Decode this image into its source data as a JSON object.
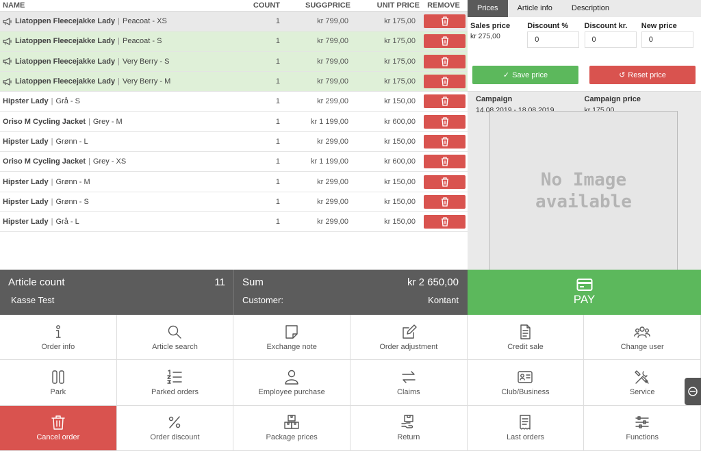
{
  "table": {
    "headers": {
      "name": "NAME",
      "count": "COUNT",
      "sugg": "SUGGPRICE",
      "unit": "UNIT PRICE",
      "remove": "REMOVE"
    },
    "rows": [
      {
        "name": "Liatoppen Fleecejakke Lady",
        "variant": "Peacoat - XS",
        "count": "1",
        "sugg": "kr 799,00",
        "unit": "kr 175,00",
        "campaign": true,
        "state": "selected"
      },
      {
        "name": "Liatoppen Fleecejakke Lady",
        "variant": "Peacoat - S",
        "count": "1",
        "sugg": "kr 799,00",
        "unit": "kr 175,00",
        "campaign": true,
        "state": "green"
      },
      {
        "name": "Liatoppen Fleecejakke Lady",
        "variant": "Very Berry - S",
        "count": "1",
        "sugg": "kr 799,00",
        "unit": "kr 175,00",
        "campaign": true,
        "state": "green"
      },
      {
        "name": "Liatoppen Fleecejakke Lady",
        "variant": "Very Berry - M",
        "count": "1",
        "sugg": "kr 799,00",
        "unit": "kr 175,00",
        "campaign": true,
        "state": "green"
      },
      {
        "name": "Hipster Lady",
        "variant": "Grå - S",
        "count": "1",
        "sugg": "kr 299,00",
        "unit": "kr 150,00",
        "campaign": false,
        "state": "normal"
      },
      {
        "name": "Oriso M Cycling Jacket",
        "variant": "Grey - M",
        "count": "1",
        "sugg": "kr 1 199,00",
        "unit": "kr 600,00",
        "campaign": false,
        "state": "normal"
      },
      {
        "name": "Hipster Lady",
        "variant": "Grønn - L",
        "count": "1",
        "sugg": "kr 299,00",
        "unit": "kr 150,00",
        "campaign": false,
        "state": "normal"
      },
      {
        "name": "Oriso M Cycling Jacket",
        "variant": "Grey - XS",
        "count": "1",
        "sugg": "kr 1 199,00",
        "unit": "kr 600,00",
        "campaign": false,
        "state": "normal"
      },
      {
        "name": "Hipster Lady",
        "variant": "Grønn - M",
        "count": "1",
        "sugg": "kr 299,00",
        "unit": "kr 150,00",
        "campaign": false,
        "state": "normal"
      },
      {
        "name": "Hipster Lady",
        "variant": "Grønn - S",
        "count": "1",
        "sugg": "kr 299,00",
        "unit": "kr 150,00",
        "campaign": false,
        "state": "normal"
      },
      {
        "name": "Hipster Lady",
        "variant": "Grå - L",
        "count": "1",
        "sugg": "kr 299,00",
        "unit": "kr 150,00",
        "campaign": false,
        "state": "normal"
      }
    ]
  },
  "panel": {
    "tabs": [
      "Prices",
      "Article info",
      "Description"
    ],
    "active_tab": "Prices",
    "sales_price_label": "Sales price",
    "sales_price_value": "kr 275,00",
    "discount_pct_label": "Discount %",
    "discount_pct_value": "0",
    "discount_kr_label": "Discount kr.",
    "discount_kr_value": "0",
    "new_price_label": "New price",
    "new_price_value": "0",
    "save_label": "Save price",
    "reset_label": "Reset price",
    "campaign_label": "Campaign",
    "campaign_value": "14.08.2019 - 18.08.2019",
    "campaign_price_label": "Campaign price",
    "campaign_price_value": "kr 175,00",
    "no_image_line1": "No Image",
    "no_image_line2": "available"
  },
  "summary": {
    "article_count_label": "Article count",
    "article_count_value": "11",
    "register_name": "Kasse Test",
    "sum_label": "Sum",
    "sum_value": "kr 2 650,00",
    "customer_label": "Customer:",
    "customer_value": "Kontant",
    "pay_label": "PAY"
  },
  "functions": [
    {
      "label": "Order info",
      "icon": "info-icon"
    },
    {
      "label": "Article search",
      "icon": "search-icon"
    },
    {
      "label": "Exchange note",
      "icon": "note-icon"
    },
    {
      "label": "Order adjustment",
      "icon": "edit-icon"
    },
    {
      "label": "Credit sale",
      "icon": "document-icon"
    },
    {
      "label": "Change user",
      "icon": "users-icon"
    },
    {
      "label": "Park",
      "icon": "pause-icon"
    },
    {
      "label": "Parked orders",
      "icon": "numbered-list-icon"
    },
    {
      "label": "Employee purchase",
      "icon": "person-icon"
    },
    {
      "label": "Claims",
      "icon": "swap-arrows-icon"
    },
    {
      "label": "Club/Business",
      "icon": "id-card-icon"
    },
    {
      "label": "Service",
      "icon": "tools-icon"
    },
    {
      "label": "Cancel order",
      "icon": "trash-icon",
      "danger": true
    },
    {
      "label": "Order discount",
      "icon": "percent-icon"
    },
    {
      "label": "Package prices",
      "icon": "boxes-icon"
    },
    {
      "label": "Return",
      "icon": "return-box-icon"
    },
    {
      "label": "Last orders",
      "icon": "receipt-icon"
    },
    {
      "label": "Functions",
      "icon": "sliders-icon"
    }
  ],
  "colors": {
    "green": "#5cb85c",
    "red": "#d9534f",
    "dark": "#5c5c5c",
    "row_green": "#dff0d8"
  }
}
